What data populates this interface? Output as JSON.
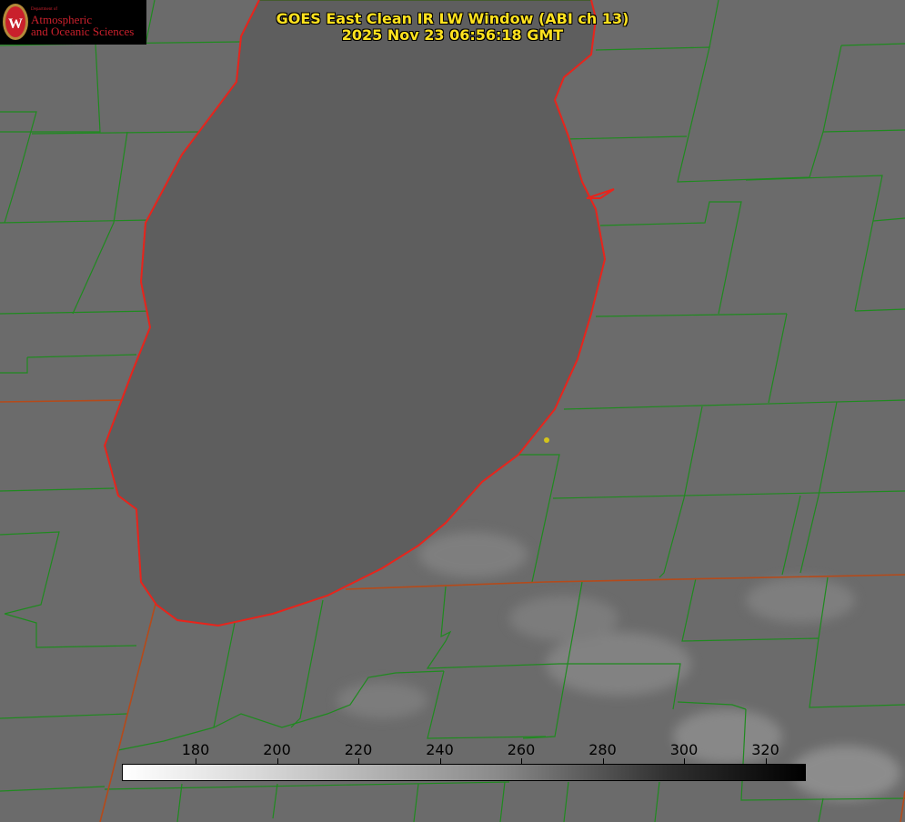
{
  "title": {
    "line1": "GOES East Clean IR LW Window (ABI ch 13)",
    "line2": "2025 Nov 23 06:56:18 GMT"
  },
  "logo": {
    "department": "Department of",
    "line1": "Atmospheric",
    "line2": "and Oceanic Sciences",
    "seal_letter": "W"
  },
  "colorbar": {
    "ticks": [
      "180",
      "200",
      "220",
      "240",
      "260",
      "280",
      "300",
      "320"
    ]
  },
  "colors": {
    "title": "#ffe21f",
    "county_lines": "#1f8a1f",
    "state_lines": "#b54a1a",
    "coastline": "#e8241c",
    "marker": "#d4c41a"
  }
}
